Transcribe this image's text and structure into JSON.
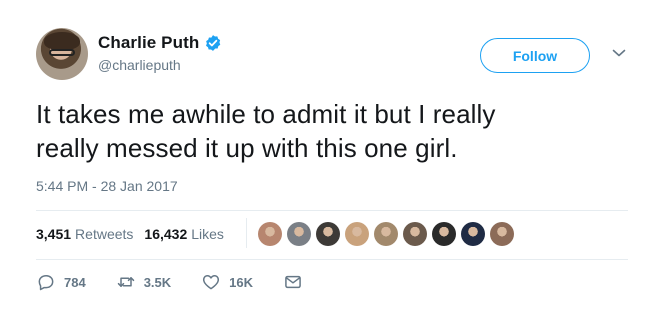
{
  "user": {
    "display_name": "Charlie Puth",
    "handle": "@charlieputh",
    "verified": true
  },
  "follow_label": "Follow",
  "tweet": {
    "line1": "It takes me awhile to admit it but I really",
    "line2": "really messed it up with this one girl.",
    "timestamp": "5:44 PM - 28 Jan 2017"
  },
  "stats": {
    "retweets": {
      "count": "3,451",
      "label": "Retweets"
    },
    "likes": {
      "count": "16,432",
      "label": "Likes"
    }
  },
  "likers": [
    {
      "name": "liker-1",
      "color": "#b7866f"
    },
    {
      "name": "liker-2",
      "color": "#7a7f86"
    },
    {
      "name": "liker-3",
      "color": "#3d3a37"
    },
    {
      "name": "liker-4",
      "color": "#c9a27c"
    },
    {
      "name": "liker-5",
      "color": "#a2896c"
    },
    {
      "name": "liker-6",
      "color": "#6b5a4c"
    },
    {
      "name": "liker-7",
      "color": "#2a2a2a"
    },
    {
      "name": "liker-8",
      "color": "#1f2b44"
    },
    {
      "name": "liker-9",
      "color": "#8c6b58"
    }
  ],
  "actions": {
    "reply": {
      "icon": "reply-icon",
      "count": "784"
    },
    "retweet": {
      "icon": "retweet-icon",
      "count": "3.5K"
    },
    "like": {
      "icon": "heart-icon",
      "count": "16K"
    },
    "dm": {
      "icon": "envelope-icon"
    }
  },
  "colors": {
    "accent": "#1da1f2",
    "text": "#14171a",
    "secondary": "#657786",
    "divider": "#e6ecf0"
  }
}
